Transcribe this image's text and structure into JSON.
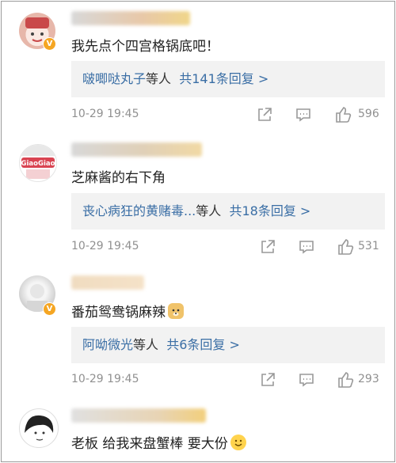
{
  "comments": [
    {
      "text": "我先点个四宫格锅底吧！",
      "replies": {
        "users": "啵唧哒丸子",
        "suffix": "等人",
        "total": "共141条回复 >"
      },
      "time": "10-29 19:45",
      "likes": "596",
      "verified": true,
      "verified_mark": "V",
      "avatar_label": "",
      "emoji": ""
    },
    {
      "text": "芝麻酱的右下角",
      "replies": {
        "users": "丧心病狂的黄赌毒...",
        "suffix": "等人",
        "total": "共18条回复 >"
      },
      "time": "10-29 19:45",
      "likes": "531",
      "verified": false,
      "avatar_label": "GiaoGiao",
      "emoji": ""
    },
    {
      "text": "番茄鸳鸯锅麻辣",
      "replies": {
        "users": "阿呦微光",
        "suffix": "等人",
        "total": "共6条回复 >"
      },
      "time": "10-29 19:45",
      "likes": "293",
      "verified": true,
      "verified_mark": "V",
      "avatar_label": "",
      "emoji": "doge-emoji"
    },
    {
      "text": "老板 给我来盘蟹棒 要大份",
      "verified": false,
      "avatar_label": "",
      "emoji": "smile-emoji"
    }
  ],
  "icons": {
    "share": "share-icon",
    "comment": "comment-icon",
    "like": "thumbs-up-icon"
  },
  "colors": {
    "link": "#3a6ea5",
    "meta": "#909090",
    "badge": "#f5a623",
    "reply_bg": "#f2f2f2"
  }
}
